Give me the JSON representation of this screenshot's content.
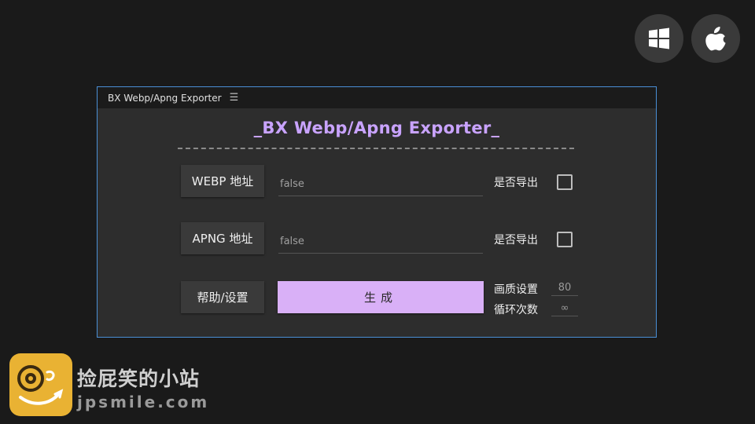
{
  "panel": {
    "tab_title": "BX Webp/Apng Exporter",
    "menu_icon": "☰",
    "title": "_BX Webp/Apng Exporter_"
  },
  "webp": {
    "button_label": "WEBP 地址",
    "path_value": "false",
    "export_label": "是否导出",
    "export_checked": false
  },
  "apng": {
    "button_label": "APNG 地址",
    "path_value": "false",
    "export_label": "是否导出",
    "export_checked": false
  },
  "actions": {
    "help_label": "帮助/设置",
    "generate_label": "生成"
  },
  "settings": {
    "quality_label": "画质设置",
    "quality_value": "80",
    "loop_label": "循环次数",
    "loop_value": "∞"
  },
  "watermark": {
    "name": "捡屁笑的小站",
    "url": "jpsmile.com"
  },
  "os_icons": [
    "windows-icon",
    "apple-icon"
  ],
  "colors": {
    "accent": "#c9a3ff",
    "generate_button": "#d9b0f7",
    "panel_border": "#4a8fd6"
  }
}
